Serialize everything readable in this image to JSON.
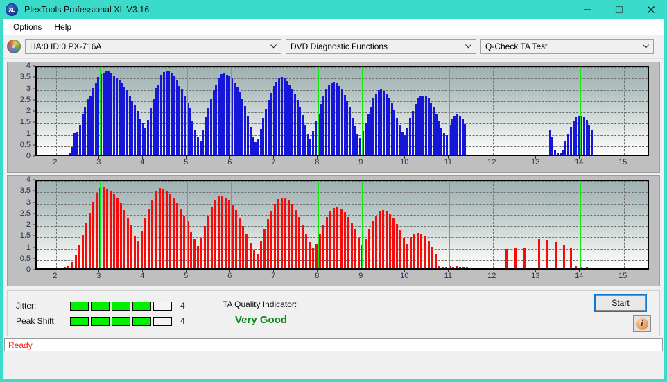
{
  "window": {
    "title": "PlexTools Professional XL V3.16",
    "app_icon": "xl-logo-icon",
    "accent_color": "#3adbcb",
    "minimize_label": "minimize-icon",
    "maximize_label": "maximize-icon",
    "close_label": "close-icon"
  },
  "menu": {
    "items": [
      {
        "label": "Options"
      },
      {
        "label": "Help"
      }
    ]
  },
  "toolbar": {
    "drive_icon": "disc-icon",
    "drive_select": {
      "value": "HA:0 ID:0  PX-716A",
      "options": [
        "HA:0 ID:0  PX-716A"
      ]
    },
    "function_select": {
      "value": "DVD Diagnostic Functions",
      "options": [
        "DVD Diagnostic Functions"
      ]
    },
    "test_select": {
      "value": "Q-Check TA Test",
      "options": [
        "Q-Check TA Test"
      ]
    },
    "chevron": "⌄"
  },
  "results": {
    "jitter": {
      "label": "Jitter:",
      "segments_total": 5,
      "segments_filled": 4,
      "value": "4"
    },
    "peak_shift": {
      "label": "Peak Shift:",
      "segments_total": 5,
      "segments_filled": 4,
      "value": "4"
    },
    "quality": {
      "label": "TA Quality Indicator:",
      "value": "Very Good",
      "color": "#0a8a1a"
    },
    "start_button": "Start",
    "info_button": "info-icon"
  },
  "statusbar": {
    "text": "Ready",
    "color": "#ff2020"
  },
  "chart_data": [
    {
      "type": "bar",
      "id": "jitter-chart",
      "title": "",
      "xlabel": "",
      "ylabel": "",
      "series_color": "#1616d8",
      "xlim": [
        1.55,
        15.6
      ],
      "ylim": [
        0,
        4
      ],
      "yticks": [
        0,
        0.5,
        1,
        1.5,
        2,
        2.5,
        3,
        3.5,
        4
      ],
      "xticks": [
        2,
        3,
        4,
        5,
        6,
        7,
        8,
        9,
        10,
        11,
        12,
        13,
        14,
        15
      ],
      "grid": true,
      "markers": [
        3,
        4,
        5,
        6,
        7,
        8,
        9,
        10,
        11,
        14
      ],
      "x": [
        2.3,
        2.36,
        2.42,
        2.48,
        2.54,
        2.6,
        2.66,
        2.72,
        2.78,
        2.84,
        2.9,
        2.96,
        3.02,
        3.08,
        3.14,
        3.2,
        3.26,
        3.32,
        3.38,
        3.44,
        3.5,
        3.56,
        3.62,
        3.68,
        3.74,
        3.8,
        3.86,
        3.92,
        3.98,
        4.04,
        4.1,
        4.16,
        4.22,
        4.28,
        4.34,
        4.4,
        4.46,
        4.52,
        4.58,
        4.64,
        4.7,
        4.76,
        4.82,
        4.88,
        4.94,
        5.0,
        5.06,
        5.12,
        5.18,
        5.24,
        5.3,
        5.36,
        5.42,
        5.48,
        5.54,
        5.6,
        5.66,
        5.72,
        5.78,
        5.84,
        5.9,
        5.96,
        6.02,
        6.08,
        6.14,
        6.2,
        6.26,
        6.32,
        6.38,
        6.44,
        6.5,
        6.56,
        6.62,
        6.68,
        6.74,
        6.8,
        6.86,
        6.92,
        6.98,
        7.04,
        7.1,
        7.16,
        7.22,
        7.28,
        7.34,
        7.4,
        7.46,
        7.52,
        7.58,
        7.64,
        7.7,
        7.76,
        7.82,
        7.88,
        7.94,
        8.0,
        8.06,
        8.12,
        8.18,
        8.24,
        8.3,
        8.36,
        8.42,
        8.48,
        8.54,
        8.6,
        8.66,
        8.72,
        8.78,
        8.84,
        8.9,
        8.96,
        9.02,
        9.08,
        9.14,
        9.2,
        9.26,
        9.32,
        9.38,
        9.44,
        9.5,
        9.56,
        9.62,
        9.68,
        9.74,
        9.8,
        9.86,
        9.92,
        9.98,
        10.04,
        10.1,
        10.16,
        10.22,
        10.28,
        10.34,
        10.4,
        10.46,
        10.52,
        10.58,
        10.64,
        10.7,
        10.76,
        10.82,
        10.88,
        10.94,
        11.0,
        11.06,
        11.12,
        11.18,
        11.24,
        11.3,
        11.36,
        13.3,
        13.36,
        13.42,
        13.48,
        13.54,
        13.6,
        13.66,
        13.72,
        13.78,
        13.84,
        13.9,
        13.96,
        14.02,
        14.08,
        14.14,
        14.2,
        14.26
      ],
      "values": [
        0.1,
        0.35,
        0.95,
        0.98,
        1.3,
        1.78,
        2.1,
        2.45,
        2.6,
        2.95,
        3.2,
        3.45,
        3.58,
        3.62,
        3.7,
        3.68,
        3.63,
        3.52,
        3.42,
        3.3,
        3.18,
        3.02,
        2.85,
        2.62,
        2.4,
        2.18,
        1.95,
        1.58,
        1.42,
        1.18,
        1.55,
        2.05,
        2.45,
        2.95,
        3.12,
        3.55,
        3.65,
        3.7,
        3.68,
        3.62,
        3.48,
        3.3,
        3.05,
        2.88,
        2.62,
        2.32,
        2.05,
        1.52,
        1.12,
        0.78,
        0.62,
        1.12,
        1.65,
        2.05,
        2.45,
        2.85,
        3.1,
        3.4,
        3.58,
        3.62,
        3.55,
        3.48,
        3.38,
        3.2,
        3.02,
        2.8,
        2.45,
        2.15,
        1.68,
        1.22,
        0.78,
        0.55,
        0.72,
        1.15,
        1.62,
        2.02,
        2.42,
        2.75,
        3.05,
        3.22,
        3.4,
        3.45,
        3.38,
        3.25,
        3.1,
        2.92,
        2.68,
        2.42,
        2.12,
        1.75,
        1.3,
        0.9,
        0.72,
        1.05,
        1.48,
        1.82,
        2.25,
        2.6,
        2.9,
        3.08,
        3.18,
        3.22,
        3.18,
        3.05,
        2.88,
        2.65,
        2.4,
        2.1,
        1.62,
        1.25,
        0.92,
        0.75,
        1.05,
        1.42,
        1.78,
        2.12,
        2.48,
        2.72,
        2.85,
        2.88,
        2.82,
        2.7,
        2.52,
        2.28,
        1.98,
        1.62,
        1.28,
        1.0,
        0.85,
        1.18,
        1.62,
        1.95,
        2.25,
        2.48,
        2.58,
        2.62,
        2.58,
        2.48,
        2.32,
        2.08,
        1.82,
        1.5,
        1.2,
        0.95,
        0.85,
        1.3,
        1.6,
        1.72,
        1.78,
        1.72,
        1.6,
        1.35,
        1.08,
        0.78,
        0.22,
        0.05,
        0.08,
        0.22,
        0.58,
        0.9,
        1.22,
        1.48,
        1.65,
        1.72,
        1.72,
        1.66,
        1.55,
        1.32,
        1.08,
        0.82,
        0.28,
        0.08
      ]
    },
    {
      "type": "bar",
      "id": "peak-shift-chart",
      "title": "",
      "xlabel": "",
      "ylabel": "",
      "series_color": "#f60a0a",
      "xlim": [
        1.55,
        15.6
      ],
      "ylim": [
        0,
        4
      ],
      "yticks": [
        0,
        0.5,
        1,
        1.5,
        2,
        2.5,
        3,
        3.5,
        4
      ],
      "xticks": [
        2,
        3,
        4,
        5,
        6,
        7,
        8,
        9,
        10,
        11,
        12,
        13,
        14,
        15
      ],
      "grid": true,
      "markers": [
        3,
        4,
        5,
        6,
        7,
        8,
        9,
        10,
        11,
        14
      ],
      "x": [
        2.2,
        2.28,
        2.36,
        2.44,
        2.52,
        2.6,
        2.68,
        2.76,
        2.84,
        2.92,
        3.0,
        3.08,
        3.16,
        3.24,
        3.32,
        3.4,
        3.48,
        3.56,
        3.64,
        3.72,
        3.8,
        3.88,
        3.96,
        4.04,
        4.12,
        4.2,
        4.28,
        4.36,
        4.44,
        4.52,
        4.6,
        4.68,
        4.76,
        4.84,
        4.92,
        5.0,
        5.08,
        5.16,
        5.24,
        5.32,
        5.4,
        5.48,
        5.56,
        5.64,
        5.72,
        5.8,
        5.88,
        5.96,
        6.04,
        6.12,
        6.2,
        6.28,
        6.36,
        6.44,
        6.52,
        6.6,
        6.68,
        6.76,
        6.84,
        6.92,
        7.0,
        7.08,
        7.16,
        7.24,
        7.32,
        7.4,
        7.48,
        7.56,
        7.64,
        7.72,
        7.8,
        7.88,
        7.96,
        8.04,
        8.12,
        8.2,
        8.28,
        8.36,
        8.44,
        8.52,
        8.6,
        8.68,
        8.76,
        8.84,
        8.92,
        9.0,
        9.08,
        9.16,
        9.24,
        9.32,
        9.4,
        9.48,
        9.56,
        9.64,
        9.72,
        9.8,
        9.88,
        9.96,
        10.04,
        10.12,
        10.2,
        10.28,
        10.36,
        10.44,
        10.52,
        10.6,
        10.68,
        10.76,
        10.84,
        10.92,
        11.0,
        11.08,
        11.16,
        11.24,
        11.32,
        11.4,
        12.3,
        12.52,
        12.72,
        13.05,
        13.25,
        13.45,
        13.62,
        13.78,
        13.9,
        14.02,
        14.14,
        14.26,
        14.38,
        14.5
      ],
      "values": [
        0.06,
        0.08,
        0.28,
        0.6,
        1.05,
        1.48,
        2.02,
        2.45,
        2.95,
        3.35,
        3.58,
        3.6,
        3.55,
        3.45,
        3.3,
        3.12,
        2.88,
        2.58,
        2.25,
        1.92,
        1.45,
        1.22,
        1.65,
        2.22,
        2.62,
        3.05,
        3.42,
        3.58,
        3.52,
        3.45,
        3.28,
        3.12,
        2.9,
        2.62,
        2.32,
        2.08,
        1.62,
        1.28,
        0.98,
        1.32,
        1.88,
        2.32,
        2.75,
        3.05,
        3.2,
        3.22,
        3.15,
        3.05,
        2.82,
        2.58,
        2.25,
        1.88,
        1.52,
        1.12,
        0.82,
        0.65,
        1.22,
        1.72,
        2.18,
        2.55,
        2.85,
        3.08,
        3.15,
        3.1,
        3.02,
        2.85,
        2.6,
        2.28,
        1.92,
        1.55,
        1.18,
        0.88,
        1.08,
        1.52,
        1.95,
        2.28,
        2.55,
        2.68,
        2.7,
        2.62,
        2.48,
        2.28,
        2.02,
        1.72,
        1.35,
        1.02,
        1.3,
        1.72,
        2.08,
        2.35,
        2.52,
        2.58,
        2.52,
        2.4,
        2.22,
        1.98,
        1.68,
        1.32,
        1.08,
        1.38,
        1.52,
        1.58,
        1.55,
        1.42,
        1.22,
        0.95,
        0.65,
        0.12,
        0.05,
        0.06,
        0.08,
        0.05,
        0.08,
        0.06,
        0.07,
        0.05,
        0.85,
        0.88,
        0.92,
        1.3,
        1.25,
        1.18,
        1.02,
        0.88,
        0.12,
        0.06,
        0.05,
        0.04,
        0.03,
        0.02
      ]
    }
  ]
}
